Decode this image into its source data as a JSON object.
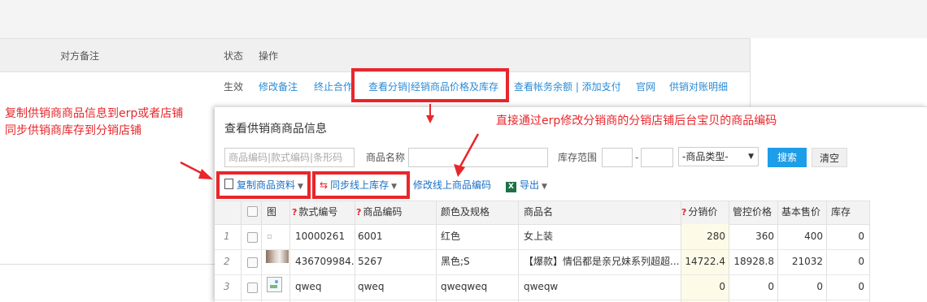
{
  "background": {
    "headers": {
      "remark": "对方备注",
      "status": "状态",
      "action": "操作"
    },
    "row": {
      "status": "生效",
      "links": [
        "修改备注",
        "终止合作",
        "查看分销|经销商品价格及库存",
        "查看帐务余额 | 添加支付",
        "官网",
        "供销对账明细"
      ]
    }
  },
  "callouts": {
    "left_text_line1": "复制供销商商品信息到erp或者店铺",
    "left_text_line2": "同步供销商库存到分销店铺",
    "right_text": "直接通过erp修改分销商的分销店铺后台宝贝的商品编码",
    "color": "#e8262b"
  },
  "modal": {
    "title": "查看供销商商品信息",
    "filters": {
      "code_placeholder": "商品编码|款式编码|条形码",
      "name_label": "商品名称",
      "stock_label": "库存范围",
      "range_sep": "-",
      "type_select": "-商品类型-",
      "search_button": "搜索",
      "clear_button": "清空"
    },
    "toolbar": {
      "copy": "复制商品资料",
      "sync": "同步线上库存",
      "modify": "修改线上商品编码",
      "export": "导出"
    },
    "table": {
      "headers": {
        "img": "图",
        "style_code": "款式编号",
        "item_code": "商品编码",
        "color_spec": "颜色及规格",
        "name": "商品名",
        "dist_price": "分销价",
        "ctrl_price": "管控价格",
        "base_price": "基本售价",
        "stock": "库存"
      },
      "rows": [
        {
          "idx": "1",
          "style_code": "10000261",
          "item_code": "6001",
          "color_spec": "红色",
          "name": "女上装",
          "dist_price": "280",
          "ctrl_price": "360",
          "base_price": "400",
          "stock": "0"
        },
        {
          "idx": "2",
          "style_code": "436709984...",
          "item_code": "5267",
          "color_spec": "黑色;S",
          "name": "【爆款】情侣都是亲兄妹系列超超...",
          "dist_price": "14722.4",
          "ctrl_price": "18928.8",
          "base_price": "21032",
          "stock": "0"
        },
        {
          "idx": "3",
          "style_code": "qweq",
          "item_code": "qweq",
          "color_spec": "qweqweq",
          "name": "qweqw",
          "dist_price": "0",
          "ctrl_price": "0",
          "base_price": "0",
          "stock": "0"
        }
      ]
    }
  }
}
